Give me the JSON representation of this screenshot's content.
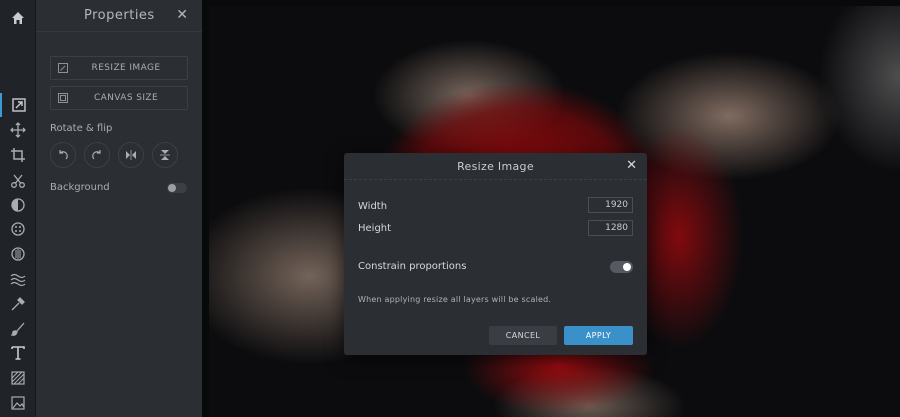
{
  "toolbar": {
    "icons": [
      "home-icon",
      "resize-icon",
      "move-icon",
      "crop-icon",
      "cut-icon",
      "adjust-icon",
      "effects-icon",
      "filter-icon",
      "waves-icon",
      "picker-icon",
      "brush-icon",
      "text-icon",
      "pattern-icon",
      "image-icon"
    ],
    "active": "resize-icon",
    "accent_color": "#3d9ad4"
  },
  "properties_panel": {
    "title": "Properties",
    "close_glyph": "✕",
    "resize_image_label": "RESIZE IMAGE",
    "canvas_size_label": "CANVAS SIZE",
    "rotate_flip_label": "Rotate & flip",
    "background_label": "Background",
    "background_enabled": false
  },
  "dialog": {
    "title": "Resize Image",
    "close_glyph": "✕",
    "width_label": "Width",
    "width_value": "1920",
    "height_label": "Height",
    "height_value": "1280",
    "constrain_label": "Constrain proportions",
    "constrain_enabled": true,
    "note": "When applying resize all layers will be scaled.",
    "cancel_label": "CANCEL",
    "apply_label": "APPLY",
    "apply_color": "#3a90c9"
  }
}
